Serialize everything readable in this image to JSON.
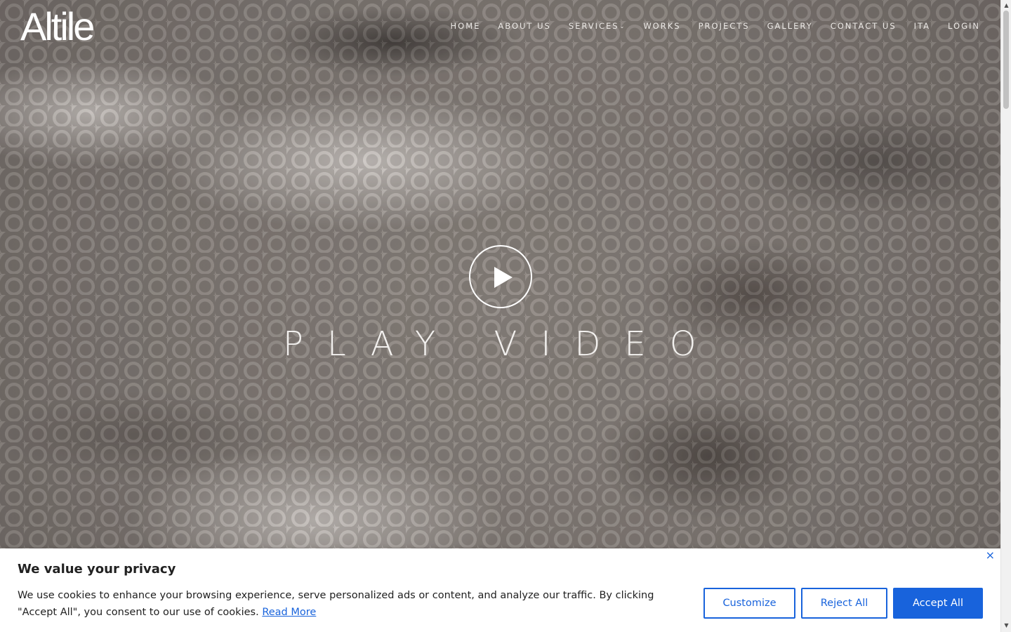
{
  "brand": {
    "logo_text": "Altile"
  },
  "nav": {
    "items": [
      {
        "label": "HOME"
      },
      {
        "label": "ABOUT US"
      },
      {
        "label": "SERVICES"
      },
      {
        "label": "WORKS"
      },
      {
        "label": "PROJECTS"
      },
      {
        "label": "GALLERY"
      },
      {
        "label": "CONTACT US"
      },
      {
        "label": "ITA"
      },
      {
        "label": "LOGIN"
      }
    ],
    "services_caret": "⌄"
  },
  "hero": {
    "play_icon": "play-icon",
    "play_label": "PLAY VIDEO"
  },
  "cookie_banner": {
    "title": "We value your privacy",
    "text": "We use cookies to enhance your browsing experience, serve personalized ads or content, and analyze our traffic. By clicking \"Accept All\", you consent to our use of cookies.",
    "read_more": "Read More",
    "close_symbol": "×",
    "buttons": {
      "customize": "Customize",
      "reject": "Reject All",
      "accept": "Accept All"
    },
    "accent_color": "#1863dc"
  }
}
